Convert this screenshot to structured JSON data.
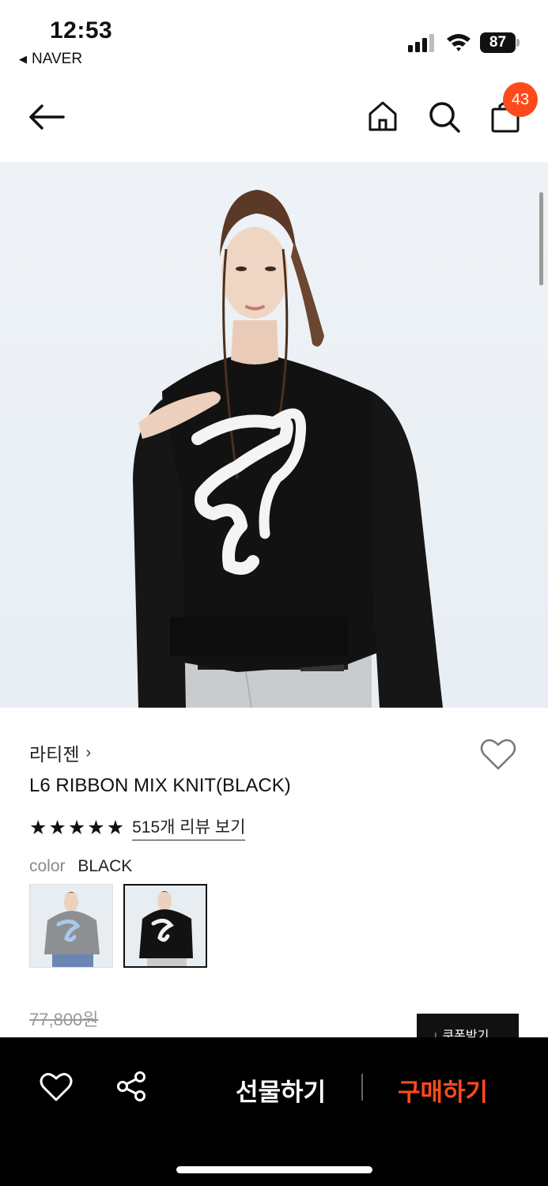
{
  "status_bar": {
    "time": "12:53",
    "back_app": "NAVER",
    "battery": "87",
    "icons": [
      "signal-icon",
      "wifi-icon",
      "battery-icon"
    ]
  },
  "header": {
    "cart_count": "43",
    "icons": [
      "back-arrow-icon",
      "home-icon",
      "search-icon",
      "shopping-bag-icon"
    ]
  },
  "product": {
    "brand": "라티젠",
    "brand_chevron": "›",
    "name": "L6 RIBBON MIX KNIT(BLACK)",
    "rating_stars": 5,
    "review_link": "515개 리뷰 보기",
    "color_label": "color",
    "color_value": "BLACK",
    "swatches": [
      {
        "name": "GRAY",
        "selected": false
      },
      {
        "name": "BLACK",
        "selected": true
      }
    ],
    "original_price": "77,800원",
    "coupon_button": "↓ 쿠폰받기"
  },
  "bottom_bar": {
    "gift_label": "선물하기",
    "buy_label": "구매하기",
    "accent_color": "#ff4a1c",
    "icons": [
      "heart-icon",
      "share-icon"
    ]
  }
}
